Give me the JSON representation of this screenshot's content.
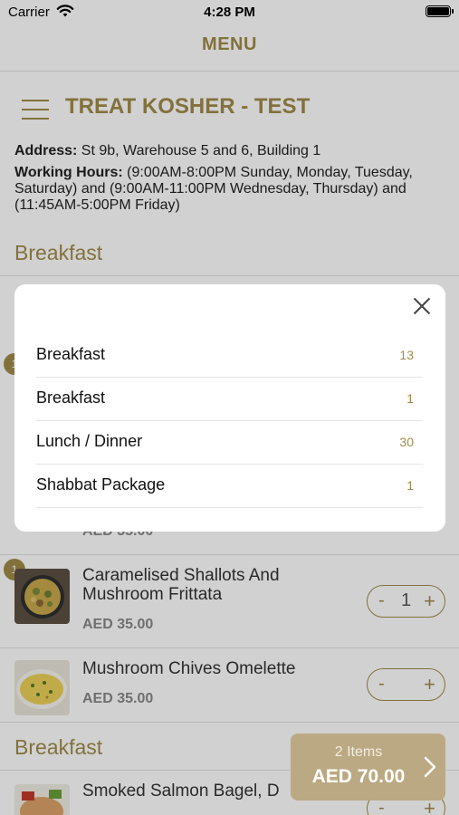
{
  "status_bar": {
    "carrier": "Carrier",
    "time": "4:28 PM"
  },
  "nav": {
    "title": "MENU"
  },
  "restaurant": {
    "name": "TREAT KOSHER - TEST",
    "address_label": "Address:",
    "address": " St 9b, Warehouse 5 and 6, Building 1",
    "hours_label": "Working Hours:",
    "hours": " (9:00AM-8:00PM  Sunday, Monday, Tuesday, Saturday) and (9:00AM-11:00PM  Wednesday, Thursday) and (11:45AM-5:00PM  Friday)"
  },
  "sections": [
    "Breakfast",
    "Breakfast"
  ],
  "items": [
    {
      "name": "Caramelised Shallots And Mushroom Frittata",
      "price": "AED 35.00",
      "qty": "1",
      "badge": "1"
    },
    {
      "name": "Mushroom Chives Omelette",
      "price": "AED 35.00",
      "qty": ""
    },
    {
      "name": "Smoked Salmon Bagel, D",
      "price": ""
    }
  ],
  "partial_price": "AED 35.00",
  "hidden_badge": "1",
  "stepper": {
    "minus": "-",
    "plus": "+"
  },
  "category_modal": {
    "rows": [
      {
        "label": "Breakfast",
        "count": "13"
      },
      {
        "label": "Breakfast",
        "count": "1"
      },
      {
        "label": "Lunch / Dinner",
        "count": "30"
      },
      {
        "label": "Shabbat Package",
        "count": "1"
      }
    ]
  },
  "cart": {
    "count": "2 Items",
    "total": "AED 70.00"
  },
  "colors": {
    "accent": "#a08a4a",
    "cart_bg": "#bba983",
    "overlay": "rgba(0,0,0,0.18)"
  },
  "icons": [
    "wifi-icon",
    "battery-icon",
    "hamburger-menu-icon",
    "close-icon",
    "chevron-right-icon"
  ]
}
